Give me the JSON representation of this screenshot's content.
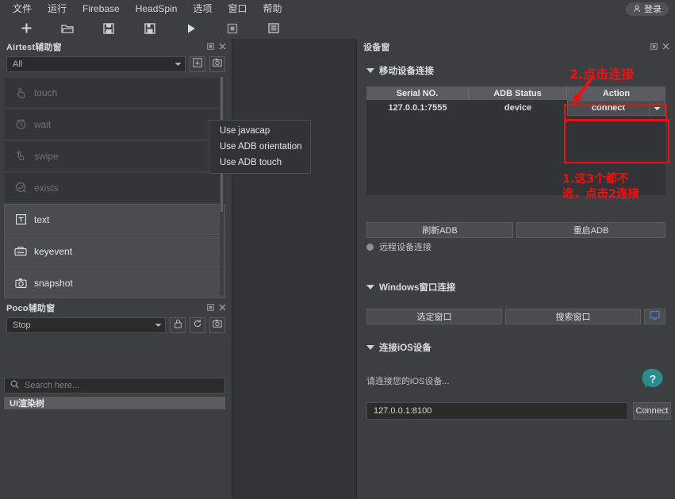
{
  "menubar": {
    "items": [
      {
        "label": "文件",
        "name": "menu-file"
      },
      {
        "label": "运行",
        "name": "menu-run"
      },
      {
        "label": "Firebase",
        "name": "menu-firebase"
      },
      {
        "label": "HeadSpin",
        "name": "menu-headspin"
      },
      {
        "label": "选项",
        "name": "menu-options"
      },
      {
        "label": "窗口",
        "name": "menu-window"
      },
      {
        "label": "帮助",
        "name": "menu-help"
      }
    ],
    "login_label": "登录"
  },
  "toolbar": {
    "buttons": [
      {
        "icon": "plus-icon",
        "name": "new-file-button"
      },
      {
        "icon": "folder-open-icon",
        "name": "open-file-button"
      },
      {
        "icon": "save-icon",
        "name": "save-button"
      },
      {
        "icon": "save-as-icon",
        "name": "save-as-button"
      },
      {
        "icon": "play-icon",
        "name": "run-button"
      },
      {
        "icon": "stop-icon",
        "name": "stop-button"
      },
      {
        "icon": "list-icon",
        "name": "log-view-button"
      }
    ]
  },
  "airtest": {
    "title": "Airtest辅助窗",
    "filter_value": "All",
    "actions": [
      {
        "label": "touch",
        "icon": "touch-icon",
        "enabled": false
      },
      {
        "label": "wait",
        "icon": "clock-icon",
        "enabled": false
      },
      {
        "label": "swipe",
        "icon": "swipe-icon",
        "enabled": false
      },
      {
        "label": "exists",
        "icon": "check-circle-icon",
        "enabled": false
      },
      {
        "label": "text",
        "icon": "text-icon",
        "enabled": true
      },
      {
        "label": "keyevent",
        "icon": "keyboard-icon",
        "enabled": true
      },
      {
        "label": "snapshot",
        "icon": "camera-icon",
        "enabled": true
      }
    ]
  },
  "poco": {
    "title": "Poco辅助窗",
    "mode_value": "Stop",
    "search_placeholder": "Search here...",
    "tree_label": "UI渲染树"
  },
  "device": {
    "title": "设备窗",
    "mobile_section": "移动设备连接",
    "table": {
      "headers": [
        "Serial NO.",
        "ADB Status",
        "Action"
      ],
      "rows": [
        {
          "serial": "127.0.0.1:7555",
          "status": "device",
          "action": "connect"
        }
      ]
    },
    "dropdown_items": [
      "Use javacap",
      "Use ADB orientation",
      "Use ADB touch"
    ],
    "refresh_adb_label": "刷新ADB",
    "restart_adb_label": "重启ADB",
    "remote_device_label": "远程设备连接",
    "windows_section": "Windows窗口连接",
    "select_window_label": "选定窗口",
    "search_window_label": "搜索窗口",
    "ios_section": "连接iOS设备",
    "ios_hint": "请连接您的iOS设备...",
    "ios_address": "127.0.0.1:8100",
    "ios_connect_label": "Connect",
    "help_icon_label": "?"
  },
  "annotations": {
    "step2": "2.点击连接",
    "step1": "1.这3个都不\n选，点击2连接",
    "accent_color": "#ee1111"
  }
}
